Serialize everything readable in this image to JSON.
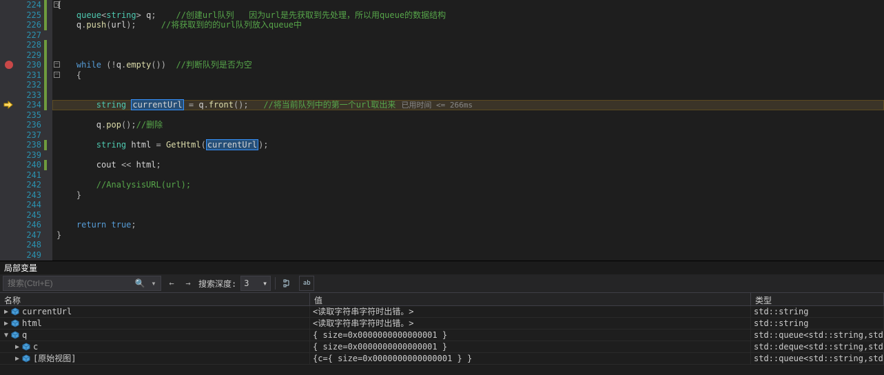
{
  "editor": {
    "lines": [
      {
        "n": 224,
        "html": "<span class='punc'>{</span>"
      },
      {
        "n": 225,
        "html": "    <span class='typ'>queue</span><span class='punc'>&lt;</span><span class='typ'>string</span><span class='punc'>&gt;</span> <span class='id'>q</span><span class='punc'>;</span>    <span class='cmt'>//创建url队列   因为url是先获取到先处理，所以用queue的数据结构</span>"
      },
      {
        "n": 226,
        "html": "    <span class='id'>q</span><span class='punc'>.</span><span class='fn'>push</span><span class='punc'>(</span><span class='id'>url</span><span class='punc'>);</span>     <span class='cmt'>//将获取到的的url队列放入queue中</span>"
      },
      {
        "n": 227,
        "html": ""
      },
      {
        "n": 228,
        "html": ""
      },
      {
        "n": 229,
        "html": ""
      },
      {
        "n": 230,
        "html": "    <span class='kw'>while</span> <span class='punc'>(!</span><span class='id'>q</span><span class='punc'>.</span><span class='fn'>empty</span><span class='punc'>())</span>  <span class='cmt'>//判断队列是否为空</span>"
      },
      {
        "n": 231,
        "html": "    <span class='punc'>{</span>"
      },
      {
        "n": 232,
        "html": ""
      },
      {
        "n": 233,
        "html": ""
      },
      {
        "n": 234,
        "html": "        <span class='typ'>string</span> <span class='sel'>currentUrl</span> <span class='punc'>=</span> <span class='id'>q</span><span class='punc'>.</span><span class='fn'>front</span><span class='punc'>();</span>   <span class='cmt'>//将当前队列中的第一个url取出来</span><span class='timing'>已用时间 &lt;= 266ms</span>"
      },
      {
        "n": 235,
        "html": ""
      },
      {
        "n": 236,
        "html": "        <span class='id'>q</span><span class='punc'>.</span><span class='fn'>pop</span><span class='punc'>();</span><span class='cmt'>//删除</span>"
      },
      {
        "n": 237,
        "html": ""
      },
      {
        "n": 238,
        "html": "        <span class='typ'>string</span> <span class='id'>html</span> <span class='punc'>=</span> <span class='fn'>GetHtml</span><span class='punc'>(</span><span class='sel'>currentUrl</span><span class='punc'>);</span>"
      },
      {
        "n": 239,
        "html": ""
      },
      {
        "n": 240,
        "html": "        <span class='id'>cout</span> <span class='punc'>&lt;&lt;</span> <span class='id'>html</span><span class='punc'>;</span>"
      },
      {
        "n": 241,
        "html": ""
      },
      {
        "n": 242,
        "html": "        <span class='cmt'>//AnalysisURL(url);</span>"
      },
      {
        "n": 243,
        "html": "    <span class='punc'>}</span>"
      },
      {
        "n": 244,
        "html": ""
      },
      {
        "n": 245,
        "html": ""
      },
      {
        "n": 246,
        "html": "    <span class='kw'>return</span> <span class='kw'>true</span><span class='punc'>;</span>"
      },
      {
        "n": 247,
        "html": "<span class='punc'>}</span>"
      },
      {
        "n": 248,
        "html": ""
      },
      {
        "n": 249,
        "html": ""
      }
    ],
    "current_line": 234,
    "breakpoint_line": 230,
    "change_bars": [
      [
        224,
        226
      ],
      [
        228,
        234
      ],
      [
        238,
        238
      ],
      [
        240,
        240
      ]
    ]
  },
  "panel_title": "局部变量",
  "toolbar": {
    "search_placeholder": "搜索(Ctrl+E)",
    "depth_label": "搜索深度:",
    "depth_value": "3"
  },
  "columns": {
    "name": "名称",
    "value": "值",
    "type": "类型"
  },
  "rows": [
    {
      "indent": 0,
      "exp": "▶",
      "name": "currentUrl",
      "value": "<读取字符串字符时出错。>",
      "type": "std::string"
    },
    {
      "indent": 0,
      "exp": "▶",
      "name": "html",
      "value": "<读取字符串字符时出错。>",
      "type": "std::string"
    },
    {
      "indent": 0,
      "exp": "▼",
      "name": "q",
      "value": "{ size=0x0000000000000001 }",
      "type": "std::queue<std::string,std::deque<"
    },
    {
      "indent": 1,
      "exp": "▶",
      "name": "c",
      "value": "{ size=0x0000000000000001 }",
      "type": "std::deque<std::string,std::allocat<"
    },
    {
      "indent": 1,
      "exp": "▶",
      "name": "[原始视图]",
      "value": "{c={ size=0x0000000000000001 } }",
      "type": "std::queue<std::string,std::deque<"
    }
  ]
}
